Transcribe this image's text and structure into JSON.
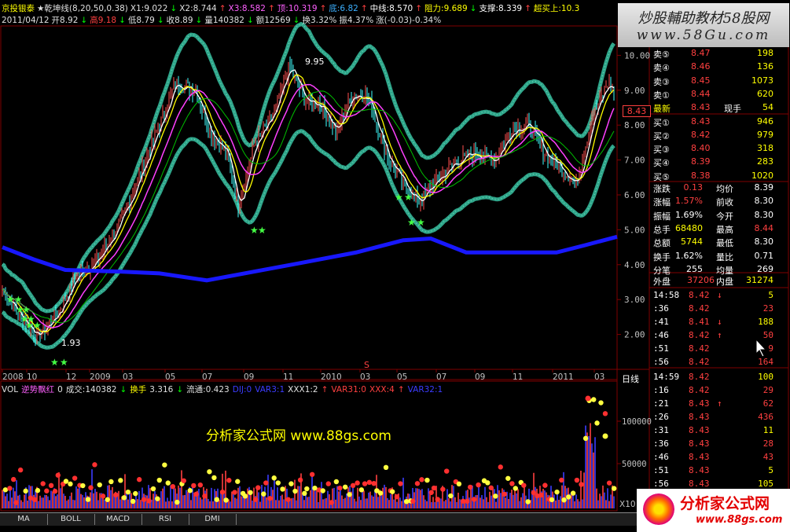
{
  "header": {
    "line1": [
      {
        "t": "京投银泰",
        "c": "#ffff00"
      },
      {
        "t": "★乾坤线(8,20,50,0.38)",
        "c": "#e0e0e0"
      },
      {
        "t": "X1:9.022",
        "c": "#e0e0e0"
      },
      {
        "t": "↓",
        "c": "#00ff00"
      },
      {
        "t": "X2:8.744",
        "c": "#e0e0e0"
      },
      {
        "t": "↑",
        "c": "#ff4040"
      },
      {
        "t": "X3:8.582",
        "c": "#ff60ff"
      },
      {
        "t": "↑",
        "c": "#ff4040"
      },
      {
        "t": "顶:10.319",
        "c": "#ff60ff"
      },
      {
        "t": "↑",
        "c": "#ff4040"
      },
      {
        "t": "底:6.82",
        "c": "#3cb0ff"
      },
      {
        "t": "↑",
        "c": "#ff4040"
      },
      {
        "t": "中线:8.570",
        "c": "#ffffff"
      },
      {
        "t": "↑",
        "c": "#ff4040"
      },
      {
        "t": "阻力:9.689",
        "c": "#ffff00"
      },
      {
        "t": "↓",
        "c": "#00ff00"
      },
      {
        "t": "支撑:8.339",
        "c": "#ffffff"
      },
      {
        "t": "↑",
        "c": "#ff4040"
      },
      {
        "t": "超买上:10.3",
        "c": "#ffff00"
      }
    ],
    "line2": [
      {
        "t": "2011/04/12",
        "c": "#e0e0e0"
      },
      {
        "t": "开8.92",
        "c": "#e0e0e0"
      },
      {
        "t": "↓",
        "c": "#00ff00"
      },
      {
        "t": "高9.18",
        "c": "#ff4040"
      },
      {
        "t": "↓",
        "c": "#00ff00"
      },
      {
        "t": "低8.79",
        "c": "#e0e0e0"
      },
      {
        "t": "↓",
        "c": "#00ff00"
      },
      {
        "t": "收8.89",
        "c": "#e0e0e0"
      },
      {
        "t": "↓",
        "c": "#00ff00"
      },
      {
        "t": "量140382",
        "c": "#e0e0e0"
      },
      {
        "t": "↓",
        "c": "#00ff00"
      },
      {
        "t": "额12569",
        "c": "#e0e0e0"
      },
      {
        "t": "↓",
        "c": "#00ff00"
      },
      {
        "t": "换3.32%",
        "c": "#e0e0e0"
      },
      {
        "t": "振4.37%",
        "c": "#e0e0e0"
      },
      {
        "t": "涨(-0.03)-0.34%",
        "c": "#e0e0e0"
      }
    ]
  },
  "watermark_top": "炒股輔助教材58股网",
  "watermark_url": "www.58Gu.com",
  "watermark_mid": "分析家公式网 www.88gs.com",
  "watermark_logo": "分析家公式网",
  "watermark_logo_url": "www.88gs.com",
  "price_axis": [
    "10.00",
    "9.00",
    "8.00",
    "7.00",
    "6.00",
    "5.00",
    "4.00",
    "3.00",
    "2.00"
  ],
  "current_price_tag": "8.43",
  "annotations": {
    "high": "9.95",
    "low": "1.93"
  },
  "time_axis": [
    "2008",
    "10",
    "12",
    "2009",
    "03",
    "05",
    "07",
    "09",
    "11",
    "2010",
    "03",
    "05",
    "07",
    "09",
    "11",
    "2011",
    "03"
  ],
  "period_label": "日线",
  "marker_s": "S",
  "volume_header": [
    {
      "t": "VOL",
      "c": "#e0e0e0"
    },
    {
      "t": "逆势飘红",
      "c": "#ff60ff"
    },
    {
      "t": "0",
      "c": "#e0e0e0"
    },
    {
      "t": "成交:140382",
      "c": "#e0e0e0"
    },
    {
      "t": "↓",
      "c": "#00ff00"
    },
    {
      "t": "换手",
      "c": "#ffff00"
    },
    {
      "t": "3.316",
      "c": "#e0e0e0"
    },
    {
      "t": "↓",
      "c": "#00ff00"
    },
    {
      "t": "流通:0.423",
      "c": "#e0e0e0"
    },
    {
      "t": "DIJ:0",
      "c": "#3c3cff"
    },
    {
      "t": "VAR3:1",
      "c": "#3c3cff"
    },
    {
      "t": "XXX1:2",
      "c": "#e0e0e0"
    },
    {
      "t": "↑",
      "c": "#ff4040"
    },
    {
      "t": "VAR31:0",
      "c": "#ff4040"
    },
    {
      "t": "XXX:4",
      "c": "#ff4040"
    },
    {
      "t": "↑",
      "c": "#ff4040"
    },
    {
      "t": "VAR32:1",
      "c": "#3c3cff"
    }
  ],
  "volume_axis": [
    "100000",
    "50000",
    "X10"
  ],
  "orderbook": [
    {
      "label": "卖⑤",
      "price": "8.47",
      "vol": "198",
      "lc": "#ffffff",
      "pc": "#ff4040",
      "vc": "#ffff00"
    },
    {
      "label": "卖④",
      "price": "8.46",
      "vol": "136",
      "lc": "#ffffff",
      "pc": "#ff4040",
      "vc": "#ffff00"
    },
    {
      "label": "卖③",
      "price": "8.45",
      "vol": "1073",
      "lc": "#ffffff",
      "pc": "#ff4040",
      "vc": "#ffff00"
    },
    {
      "label": "卖①",
      "price": "8.44",
      "vol": "620",
      "lc": "#ffffff",
      "pc": "#ff4040",
      "vc": "#ffff00"
    },
    {
      "label": "最新",
      "price": "8.43",
      "vol": "54",
      "lc": "#ffff00",
      "pc": "#ff4040",
      "vc": "#ffff00",
      "mid": "现手"
    },
    {
      "label": "买①",
      "price": "8.43",
      "vol": "946",
      "lc": "#ffffff",
      "pc": "#ff4040",
      "vc": "#ffff00"
    },
    {
      "label": "买②",
      "price": "8.42",
      "vol": "979",
      "lc": "#ffffff",
      "pc": "#ff4040",
      "vc": "#ffff00"
    },
    {
      "label": "买③",
      "price": "8.40",
      "vol": "318",
      "lc": "#ffffff",
      "pc": "#ff4040",
      "vc": "#ffff00"
    },
    {
      "label": "买④",
      "price": "8.39",
      "vol": "283",
      "lc": "#ffffff",
      "pc": "#ff4040",
      "vc": "#ffff00"
    },
    {
      "label": "买⑤",
      "price": "8.38",
      "vol": "1020",
      "lc": "#ffffff",
      "pc": "#ff4040",
      "vc": "#ffff00"
    }
  ],
  "stats": [
    {
      "l1": "涨跌",
      "v1": "0.13",
      "l2": "均价",
      "v2": "8.39",
      "c1": "#ff4040",
      "c2": "#ffffff"
    },
    {
      "l1": "涨幅",
      "v1": "1.57%",
      "l2": "前收",
      "v2": "8.30",
      "c1": "#ff4040",
      "c2": "#ffffff"
    },
    {
      "l1": "振幅",
      "v1": "1.69%",
      "l2": "今开",
      "v2": "8.30",
      "c1": "#ffffff",
      "c2": "#ffffff"
    },
    {
      "l1": "总手",
      "v1": "68480",
      "l2": "最高",
      "v2": "8.44",
      "c1": "#ffff00",
      "c2": "#ff4040"
    },
    {
      "l1": "总额",
      "v1": "5744",
      "l2": "最低",
      "v2": "8.30",
      "c1": "#ffff00",
      "c2": "#ffffff"
    },
    {
      "l1": "换手",
      "v1": "1.62%",
      "l2": "量比",
      "v2": "0.71",
      "c1": "#ffffff",
      "c2": "#ffffff"
    },
    {
      "l1": "分笔",
      "v1": "255",
      "l2": "均量",
      "v2": "269",
      "c1": "#ffffff",
      "c2": "#ffffff"
    }
  ],
  "outer_inner": {
    "outer_label": "外盘",
    "outer": "37206",
    "inner_label": "内盘",
    "inner": "31274"
  },
  "ticks": [
    {
      "t": "14:58",
      "p": "8.42",
      "a": "↓",
      "v": "5",
      "ac": "#ff4040"
    },
    {
      "t": ":36",
      "p": "8.42",
      "a": "",
      "v": "23",
      "ac": "#ff4040"
    },
    {
      "t": ":41",
      "p": "8.41",
      "a": "↓",
      "v": "188",
      "ac": "#ff4040"
    },
    {
      "t": ":46",
      "p": "8.42",
      "a": "↑",
      "v": "50",
      "ac": "#ff4040"
    },
    {
      "t": ":51",
      "p": "8.42",
      "a": "",
      "v": "9",
      "ac": "#ff4040"
    },
    {
      "t": ":56",
      "p": "8.42",
      "a": "",
      "v": "164",
      "ac": "#ff4040"
    },
    {
      "t": "14:59",
      "p": "8.42",
      "a": "",
      "v": "100",
      "ac": "#ff4040"
    },
    {
      "t": ":16",
      "p": "8.42",
      "a": "",
      "v": "29",
      "ac": "#ff4040"
    },
    {
      "t": ":21",
      "p": "8.43",
      "a": "↑",
      "v": "62",
      "ac": "#ff4040"
    },
    {
      "t": ":26",
      "p": "8.43",
      "a": "",
      "v": "436",
      "ac": "#ff4040"
    },
    {
      "t": ":31",
      "p": "8.43",
      "a": "",
      "v": "11",
      "ac": "#ff4040"
    },
    {
      "t": ":36",
      "p": "8.43",
      "a": "",
      "v": "28",
      "ac": "#ff4040"
    },
    {
      "t": ":46",
      "p": "8.43",
      "a": "",
      "v": "43",
      "ac": "#ff4040"
    },
    {
      "t": ":51",
      "p": "8.43",
      "a": "",
      "v": "5",
      "ac": "#ff4040"
    },
    {
      "t": ":56",
      "p": "8.43",
      "a": "",
      "v": "105",
      "ac": "#ff4040"
    }
  ],
  "tabs": [
    "MA",
    "BOLL",
    "MACD",
    "RSI",
    "DMI"
  ],
  "colors": {
    "grid": "#800000",
    "band": "#2fa58a",
    "ma_long": "#1818ff",
    "star": "#44ff44",
    "price_up": "#ff4040",
    "price_dn": "#00ffff"
  }
}
